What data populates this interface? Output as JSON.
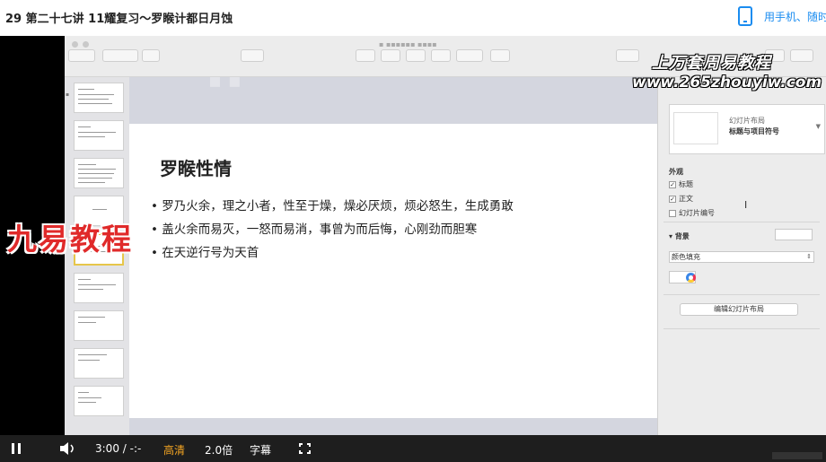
{
  "header": {
    "title": "29 第二十七讲 11耀复习～罗睺计都日月蚀",
    "mobile_link": "用手机、随时"
  },
  "slide": {
    "title": "罗睺性情",
    "bullets": [
      "罗乃火余，理之小者，性至于燥，燥必厌烦，烦必怒生，生成勇敢",
      "盖火余而易灭，一怒而易消，事曾为而后悔，心刚劲而胆寒",
      "在天逆行号为天首"
    ]
  },
  "inspector": {
    "layout_label": "幻灯片布局",
    "layout_value": "标题与项目符号",
    "appearance_title": "外观",
    "chk_title": "标题",
    "chk_body": "正文",
    "chk_number": "幻灯片编号",
    "background_title": "背景",
    "fill_select": "颜色填充",
    "edit_layout_button": "编辑幻灯片布局"
  },
  "watermarks": {
    "brand_top": "上万套周易教程",
    "url": "www.265zhouyiw.com",
    "brand_left": "九易教程"
  },
  "controls": {
    "time": "3:00 / -:-",
    "quality": "高清",
    "speed": "2.0倍",
    "subtitle": "字幕"
  },
  "colors": {
    "accent": "#1a8cf0",
    "hd": "#f5a623",
    "watermark_red": "#e02a2a"
  }
}
